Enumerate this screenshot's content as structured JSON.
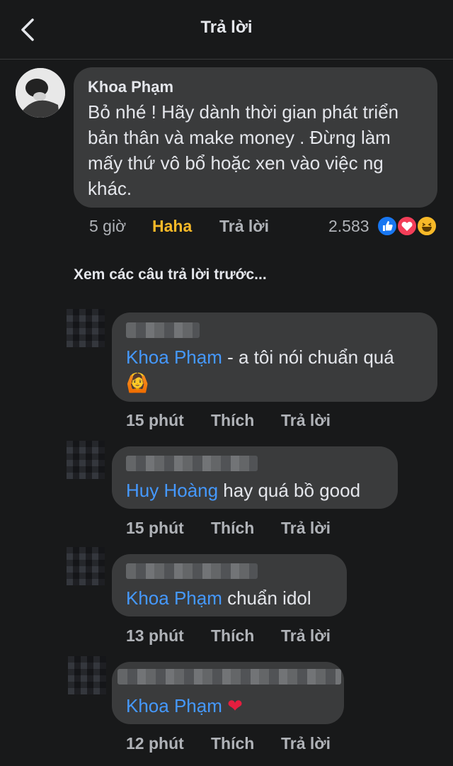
{
  "header": {
    "title": "Trả lời"
  },
  "parent_comment": {
    "author": "Khoa Phạm",
    "lines": [
      "Bỏ nhé ! Hãy dành thời gian phát triển",
      "bản thân và make money . Đừng làm",
      "mấy thứ vô bổ hoặc xen vào việc ng",
      "khác."
    ],
    "time": "5 giờ",
    "reaction_label": "Haha",
    "reply_label": "Trả lời",
    "reaction_count": "2.583",
    "reaction_icons": [
      "like-icon",
      "love-icon",
      "haha-icon"
    ]
  },
  "see_more": "Xem các câu trả lời trước...",
  "replies": [
    {
      "mention": "Khoa Phạm",
      "text": " - a tôi nói chuẩn quá",
      "line2": "🙆",
      "time": "15 phút",
      "like": "Thích",
      "reply": "Trả lời"
    },
    {
      "mention": "Huy Hoàng",
      "text": " hay quá bồ good",
      "time": "15 phút",
      "like": "Thích",
      "reply": "Trả lời"
    },
    {
      "mention": "Khoa Phạm",
      "text": " chuẩn idol",
      "time": "13 phút",
      "like": "Thích",
      "reply": "Trả lời"
    },
    {
      "mention": "Khoa Phạm",
      "text": "  ❤",
      "time": "12 phút",
      "like": "Thích",
      "reply": "Trả lời"
    }
  ],
  "colors": {
    "background": "#18191a",
    "bubble": "#3a3b3c",
    "mention": "#4599ff",
    "haha": "#f7b928",
    "meta": "#b0b3b8"
  }
}
